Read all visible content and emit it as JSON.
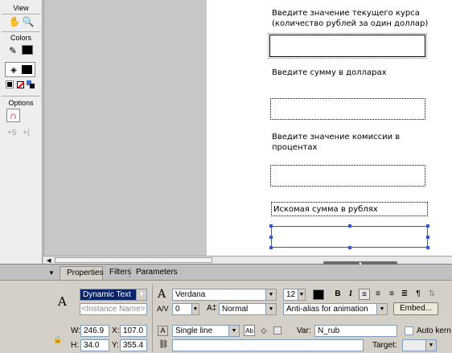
{
  "tools": {
    "view_label": "View",
    "colors_label": "Colors",
    "options_label": "Options"
  },
  "stage": {
    "label1_line1": "Введите значение текущего курса",
    "label1_line2": "(количество рублей за один доллар)",
    "label2": "Введите сумму в долларах",
    "label3_line1": "Введите значение комиссии в",
    "label3_line2": "процентах",
    "label4": "Искомая сумма в рублях"
  },
  "properties": {
    "tabs": [
      "Properties",
      "Filters",
      "Parameters"
    ],
    "text_type": "Dynamic Text",
    "instance_name_placeholder": "<Instance Name>",
    "font": "Verdana",
    "font_size": "12",
    "letter_spacing": "0",
    "baseline": "Normal",
    "anti_alias": "Anti-alias for animation",
    "embed_label": "Embed...",
    "w_label": "W:",
    "w_value": "246.9",
    "x_label": "X:",
    "x_value": "107.0",
    "h_label": "H:",
    "h_value": "34.0",
    "y_label": "Y:",
    "y_value": "355.4",
    "line_type": "Single line",
    "var_label": "Var:",
    "var_value": "N_rub",
    "auto_kern_label": "Auto kern",
    "target_label": "Target:"
  },
  "colors": {
    "selection": "#2a5ad8",
    "stage_bg": "#ffffff",
    "pasteboard": "#c8c8c8"
  }
}
